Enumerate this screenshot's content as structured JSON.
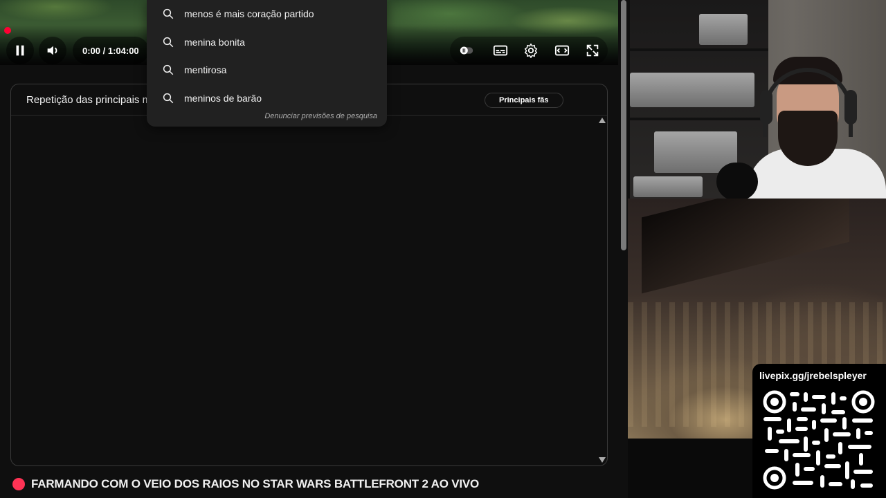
{
  "player": {
    "time_display": "0:00 / 1:04:00",
    "play_state_icon": "pause-icon",
    "volume_icon": "volume-icon",
    "progress_fraction": 0.0,
    "right_controls": [
      "autoplay-toggle-icon",
      "subtitles-icon",
      "settings-gear-icon",
      "theater-mode-icon",
      "fullscreen-icon"
    ]
  },
  "search_suggestions": {
    "items": [
      "menos é mais coração partido",
      "menina bonita",
      "mentirosa",
      "meninos de barão"
    ],
    "report_link": "Denunciar previsões de pesquisa"
  },
  "chat": {
    "title": "Repetição das principais mensagens do chat",
    "filter_button": "Principais fãs"
  },
  "stream": {
    "title": "FARMANDO COM O VEIO DOS RAIOS NO STAR WARS BATTLEFRONT 2 AO VIVO"
  },
  "overlay": {
    "url": "livepix.gg/jrebelspleyer"
  },
  "colors": {
    "background": "#0f0f0f",
    "live_dot": "#ff3355",
    "progress_red": "#ff0033",
    "dropdown_bg": "#212121"
  }
}
